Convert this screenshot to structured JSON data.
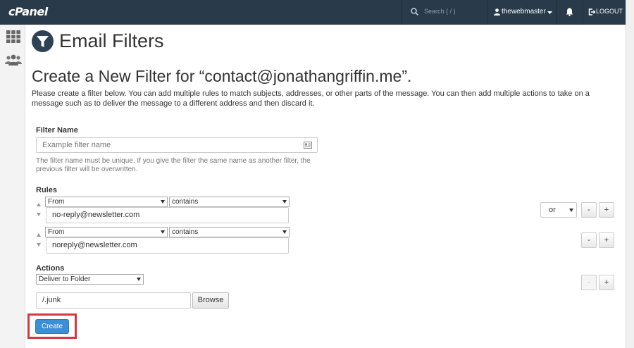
{
  "topbar": {
    "logo": "cPanel",
    "search_placeholder": "Search ( / )",
    "username": "thewebmaster",
    "logout_label": "LOGOUT"
  },
  "page": {
    "title": "Email Filters",
    "subtitle": "Create a New Filter for “contact@jonathangriffin.me”.",
    "description": "Please create a filter below. You can add multiple rules to match subjects, addresses, or other parts of the message. You can then add multiple actions to take on a message such as to deliver the message to a different address and then discard it."
  },
  "filter_name": {
    "label": "Filter Name",
    "placeholder": "Example filter name",
    "help": "The filter name must be unique. If you give the filter the same name as another filter, the previous filter will be overwritten."
  },
  "rules": {
    "label": "Rules",
    "items": [
      {
        "field": "From",
        "operator": "contains",
        "value": "no-reply@newsletter.com",
        "connector": "or"
      },
      {
        "field": "From",
        "operator": "contains",
        "value": "noreply@newsletter.com"
      }
    ],
    "remove_label": "-",
    "add_label": "+"
  },
  "actions": {
    "label": "Actions",
    "items": [
      {
        "action": "Deliver to Folder",
        "destination": "/.junk"
      }
    ],
    "browse_label": "Browse",
    "remove_label": "-",
    "add_label": "+"
  },
  "create_label": "Create",
  "colors": {
    "topbar": "#293a4a",
    "primary_button": "#3b8fd6",
    "highlight": "#d9363e"
  }
}
